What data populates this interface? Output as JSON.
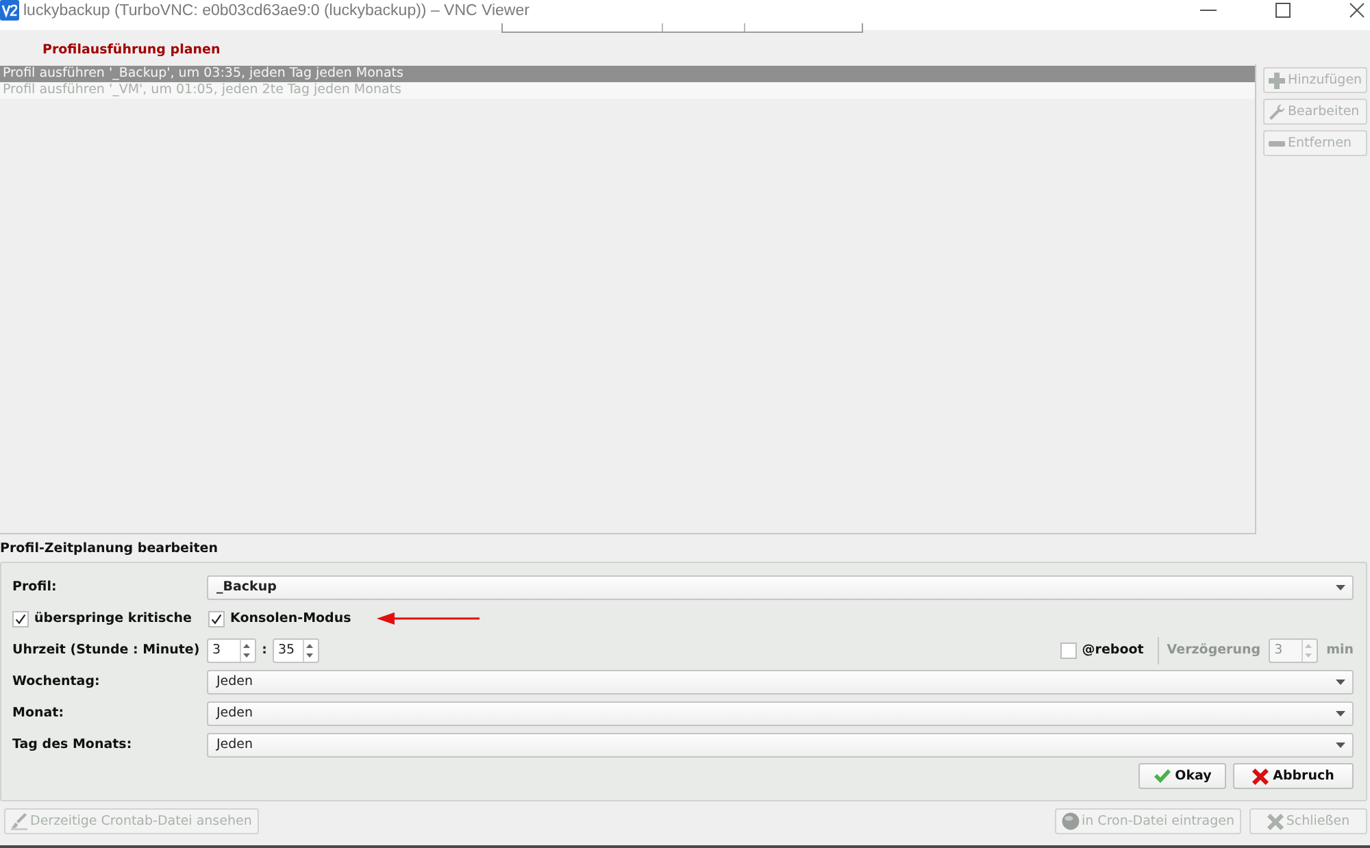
{
  "window": {
    "title": "luckybackup (TurboVNC: e0b03cd63ae9:0 (luckybackup)) – VNC Viewer"
  },
  "schedule": {
    "title": "Profilausführung planen",
    "items": [
      {
        "text": "Profil ausführen '_Backup', um 03:35, jeden Tag jeden Monats",
        "selected": true,
        "disabled": false
      },
      {
        "text": "Profil ausführen '_VM', um 01:05, jeden 2te Tag jeden Monats",
        "selected": false,
        "disabled": true
      }
    ]
  },
  "list_buttons": [
    {
      "kind": "add",
      "label": "Hinzufügen",
      "disabled": true
    },
    {
      "kind": "edit",
      "label": "Bearbeiten",
      "disabled": true
    },
    {
      "kind": "remove",
      "label": "Entfernen",
      "disabled": true
    }
  ],
  "editor": {
    "title": "Profil-Zeitplanung bearbeiten",
    "profile": {
      "label": "Profil:",
      "value": "_Backup"
    },
    "options": [
      {
        "label": "überspringe kritische",
        "checked": true
      },
      {
        "label": "Konsolen-Modus",
        "checked": true
      }
    ],
    "time": {
      "label": "Uhrzeit (Stunde : Minute)",
      "hour": "3",
      "separator": ":",
      "minute": "35"
    },
    "reboot": {
      "label": "@reboot",
      "checked": false
    },
    "delay": {
      "label": "Verzögerung",
      "value": "3",
      "unit": "min",
      "disabled": true
    },
    "fields": [
      {
        "label": "Wochentag:",
        "value": "Jeden"
      },
      {
        "label": "Monat:",
        "value": "Jeden"
      },
      {
        "label": "Tag des Monats:",
        "value": "Jeden"
      }
    ],
    "buttons": [
      {
        "kind": "ok",
        "label": "Okay"
      },
      {
        "kind": "cancel",
        "label": "Abbruch"
      }
    ]
  },
  "footer_buttons": [
    {
      "kind": "view",
      "label": "Derzeitige Crontab-Datei ansehen",
      "disabled": true
    },
    {
      "kind": "install",
      "label": "in Cron-Datei eintragen",
      "disabled": true
    },
    {
      "kind": "close",
      "label": "Schließen",
      "disabled": true
    }
  ]
}
